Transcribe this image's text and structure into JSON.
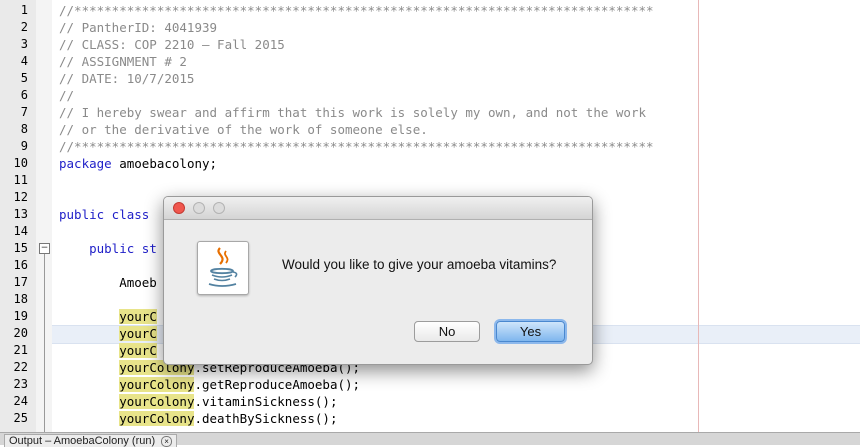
{
  "editor": {
    "lines": [
      {
        "num": "1",
        "parts": [
          {
            "t": "//*****************************************************************************",
            "c": "cm"
          }
        ]
      },
      {
        "num": "2",
        "parts": [
          {
            "t": "// PantherID: 4041939",
            "c": "cm"
          }
        ]
      },
      {
        "num": "3",
        "parts": [
          {
            "t": "// CLASS: COP 2210 – Fall 2015",
            "c": "cm"
          }
        ]
      },
      {
        "num": "4",
        "parts": [
          {
            "t": "// ASSIGNMENT # 2",
            "c": "cm"
          }
        ]
      },
      {
        "num": "5",
        "parts": [
          {
            "t": "// DATE: 10/7/2015",
            "c": "cm"
          }
        ]
      },
      {
        "num": "6",
        "parts": [
          {
            "t": "//",
            "c": "cm"
          }
        ]
      },
      {
        "num": "7",
        "parts": [
          {
            "t": "// I hereby swear and affirm that this work is solely my own, and not the work",
            "c": "cm"
          }
        ]
      },
      {
        "num": "8",
        "parts": [
          {
            "t": "// or the derivative of the work of someone else.",
            "c": "cm"
          }
        ]
      },
      {
        "num": "9",
        "parts": [
          {
            "t": "//*****************************************************************************",
            "c": "cm"
          }
        ]
      },
      {
        "num": "10",
        "parts": [
          {
            "t": "package",
            "c": "kw"
          },
          {
            "t": " amoebacolony;",
            "c": ""
          }
        ]
      },
      {
        "num": "11",
        "parts": []
      },
      {
        "num": "12",
        "parts": []
      },
      {
        "num": "13",
        "parts": [
          {
            "t": "public class ",
            "c": "kw"
          }
        ]
      },
      {
        "num": "14",
        "parts": []
      },
      {
        "num": "15",
        "parts": [
          {
            "t": "    ",
            "c": ""
          },
          {
            "t": "public st",
            "c": "kw"
          }
        ]
      },
      {
        "num": "16",
        "parts": []
      },
      {
        "num": "17",
        "parts": [
          {
            "t": "        Amoeb",
            "c": ""
          }
        ]
      },
      {
        "num": "18",
        "parts": []
      },
      {
        "num": "19",
        "parts": [
          {
            "t": "        ",
            "c": ""
          },
          {
            "t": "yourC",
            "c": "hl"
          }
        ]
      },
      {
        "num": "20",
        "parts": [
          {
            "t": "        ",
            "c": ""
          },
          {
            "t": "yourC",
            "c": "hl"
          }
        ]
      },
      {
        "num": "21",
        "parts": [
          {
            "t": "        ",
            "c": ""
          },
          {
            "t": "yourC",
            "c": "hl"
          }
        ]
      },
      {
        "num": "22",
        "parts": [
          {
            "t": "        ",
            "c": ""
          },
          {
            "t": "yourColony",
            "c": "hl"
          },
          {
            "t": ".setReproduceAmoeba();",
            "c": ""
          }
        ]
      },
      {
        "num": "23",
        "parts": [
          {
            "t": "        ",
            "c": ""
          },
          {
            "t": "yourColony",
            "c": "hl"
          },
          {
            "t": ".getReproduceAmoeba();",
            "c": ""
          }
        ]
      },
      {
        "num": "24",
        "parts": [
          {
            "t": "        ",
            "c": ""
          },
          {
            "t": "yourColony",
            "c": "hl"
          },
          {
            "t": ".vitaminSickness();",
            "c": ""
          }
        ]
      },
      {
        "num": "25",
        "parts": [
          {
            "t": "        ",
            "c": ""
          },
          {
            "t": "yourColony",
            "c": "hl"
          },
          {
            "t": ".deathBySickness();",
            "c": ""
          }
        ]
      }
    ],
    "fold_symbol": "−"
  },
  "output_tab": {
    "label": "Output – AmoebaColony (run)",
    "close_symbol": "×"
  },
  "dialog": {
    "message": "Would you like to give your amoeba vitamins?",
    "no_label": "No",
    "yes_label": "Yes",
    "icon": "java-icon"
  },
  "colors": {
    "comment": "#8a8a8a",
    "keyword": "#1f1fc8",
    "highlight": "#e8e48a",
    "close": "#f0574e",
    "default_button": "#7fb6ee"
  }
}
